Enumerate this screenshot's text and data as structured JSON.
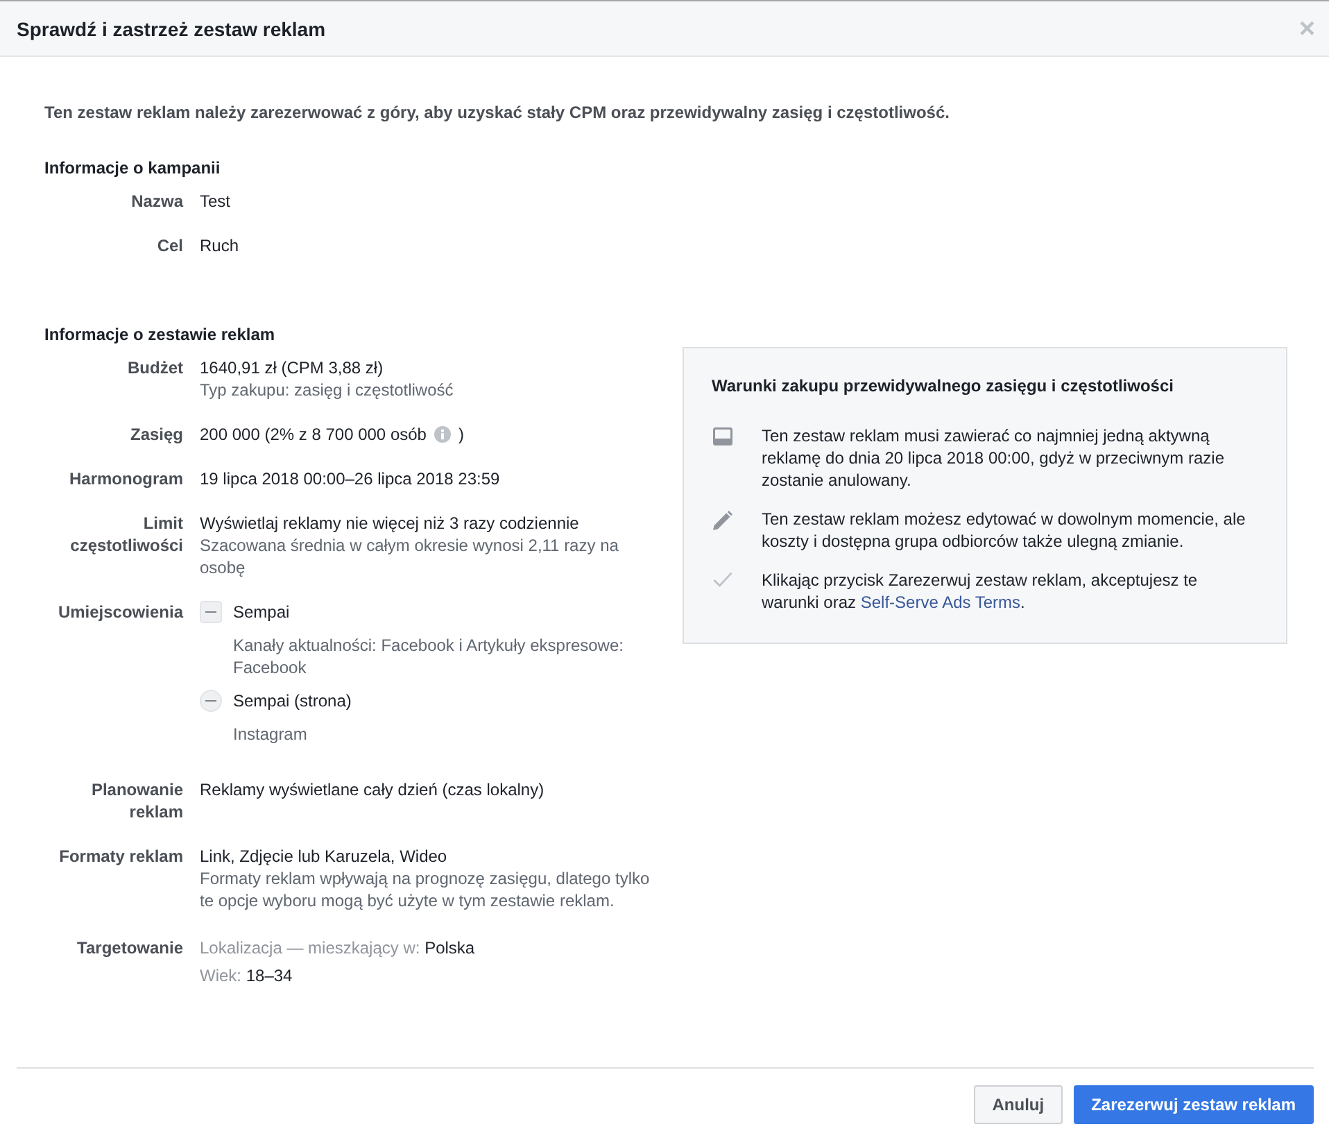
{
  "dialog": {
    "title": "Sprawdź i zastrzeż zestaw reklam",
    "close": "×"
  },
  "intro": "Ten zestaw reklam należy zarezerwować z góry, aby uzyskać stały CPM oraz przewidywalny zasięg i częstotliwość.",
  "campaign": {
    "heading": "Informacje o kampanii",
    "rows": [
      {
        "kind": "text",
        "label": "Nazwa",
        "value": "Test"
      },
      {
        "kind": "text",
        "label": "Cel",
        "value": "Ruch"
      }
    ]
  },
  "ad_set": {
    "heading": "Informacje o zestawie reklam",
    "rows": [
      {
        "kind": "text",
        "label": "Budżet",
        "value": "1640,91 zł (CPM 3,88 zł)",
        "note": "Typ zakupu: zasięg i częstotliwość"
      },
      {
        "kind": "reach",
        "label": "Zasięg",
        "value": "200 000 (2% z 8 700 000 osób",
        "suffix": ")"
      },
      {
        "kind": "text",
        "label": "Harmonogram",
        "value": "19 lipca 2018 00:00–26 lipca 2018 23:59"
      },
      {
        "kind": "text",
        "label": "Limit częstotliwości",
        "value": "Wyświetlaj reklamy nie więcej niż 3 razy codziennie",
        "note": "Szacowana średnia w całym okresie wynosi 2,11 razy na osobę"
      },
      {
        "kind": "placements",
        "label": "Umiejscowienia",
        "pages": [
          {
            "kind": "square",
            "name": "Sempai",
            "channels": "Kanały aktualności: Facebook i Artykuły ekspresowe: Facebook"
          },
          {
            "kind": "round",
            "name": "Sempai (strona)",
            "channels": "Instagram"
          }
        ]
      },
      {
        "kind": "text",
        "label": "Planowanie reklam",
        "value": "Reklamy wyświetlane cały dzień (czas lokalny)"
      },
      {
        "kind": "text",
        "label": "Formaty reklam",
        "value": "Link, Zdjęcie lub Karuzela, Wideo",
        "note": "Formaty reklam wpływają na prognozę zasięgu, dlatego tylko te opcje wyboru mogą być użyte w tym zestawie reklam."
      },
      {
        "kind": "targeting",
        "label": "Targetowanie",
        "criteria": [
          {
            "key": "Lokalizacja — mieszkający w:",
            "value": "Polska"
          },
          {
            "key": "Wiek:",
            "value": "18–34"
          }
        ]
      }
    ]
  },
  "terms_panel": {
    "heading": "Warunki zakupu przewidywalnego zasięgu i częstotliwości",
    "items": [
      {
        "kind": "layout",
        "text": "Ten zestaw reklam musi zawierać co najmniej jedną aktywną reklamę do dnia 20 lipca 2018 00:00, gdyż w przeciwnym razie zostanie anulowany."
      },
      {
        "kind": "pencil",
        "text": "Ten zestaw reklam możesz edytować w dowolnym momencie, ale koszty i dostępna grupa odbiorców także ulegną zmianie."
      },
      {
        "kind": "check",
        "text": "Klikając przycisk Zarezerwuj zestaw reklam, akceptujesz te warunki oraz",
        "link": "Self-Serve Ads Terms",
        "after": "."
      }
    ]
  },
  "buttons": [
    {
      "kind": "secondary",
      "label": "Anuluj"
    },
    {
      "kind": "primary",
      "label": "Zarezerwuj zestaw reklam"
    }
  ]
}
